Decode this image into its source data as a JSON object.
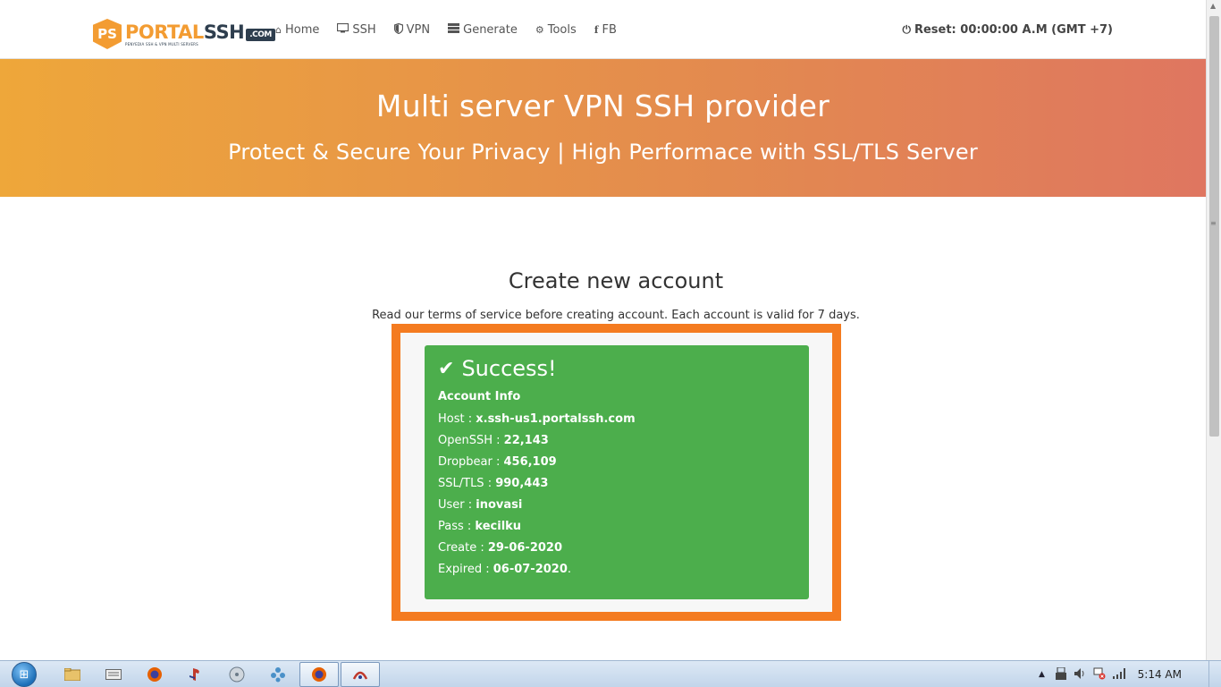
{
  "brand": {
    "badge": "PS",
    "name_part1": "PORTAL",
    "name_part2": "SSH",
    "tld": ".COM",
    "tagline": "PENYEDIA SSH & VPN MULTI SERVERS"
  },
  "nav": {
    "items": [
      {
        "label": "Home",
        "icon": "home-icon"
      },
      {
        "label": "SSH",
        "icon": "monitor-icon"
      },
      {
        "label": "VPN",
        "icon": "shield-icon"
      },
      {
        "label": "Generate",
        "icon": "server-icon"
      },
      {
        "label": "Tools",
        "icon": "gears-icon"
      },
      {
        "label": "FB",
        "icon": "facebook-icon"
      }
    ],
    "reset_label": "Reset: 00:00:00 A.M (GMT +7)"
  },
  "hero": {
    "title": "Multi server VPN SSH provider",
    "subtitle": "Protect & Secure Your Privacy | High Performace with SSL/TLS Server"
  },
  "main": {
    "title": "Create new account",
    "subtitle": "Read our terms of service before creating account. Each account is valid for 7 days."
  },
  "alert": {
    "title": "Success!",
    "section_heading": "Account Info",
    "rows": [
      {
        "label": "Host : ",
        "value": "x.ssh-us1.portalssh.com",
        "suffix": ""
      },
      {
        "label": "OpenSSH : ",
        "value": "22,143",
        "suffix": ""
      },
      {
        "label": "Dropbear : ",
        "value": "456,109",
        "suffix": ""
      },
      {
        "label": "SSL/TLS : ",
        "value": "990,443",
        "suffix": ""
      },
      {
        "label": "User : ",
        "value": "inovasi",
        "suffix": ""
      },
      {
        "label": "Pass : ",
        "value": "kecilku",
        "suffix": ""
      },
      {
        "label": "Create : ",
        "value": "29-06-2020",
        "suffix": ""
      },
      {
        "label": "Expired : ",
        "value": "06-07-2020",
        "suffix": "."
      }
    ],
    "colors": {
      "background": "#4cae4c",
      "highlight_border": "#f47b20"
    }
  },
  "taskbar": {
    "clock": "5:14 AM"
  },
  "colors": {
    "accent": "#f39c32",
    "hero_start": "#eea73a",
    "hero_end": "#df7660"
  }
}
